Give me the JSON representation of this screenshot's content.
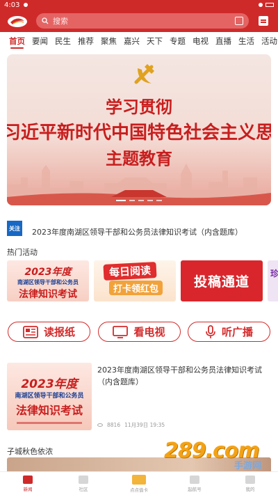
{
  "status_bar": {
    "time": "4:03"
  },
  "header": {
    "search_placeholder": "搜索"
  },
  "tabs": [
    {
      "label": "首页",
      "active": true
    },
    {
      "label": "要闻"
    },
    {
      "label": "民生"
    },
    {
      "label": "推荐"
    },
    {
      "label": "聚焦"
    },
    {
      "label": "嘉兴"
    },
    {
      "label": "天下"
    },
    {
      "label": "专题"
    },
    {
      "label": "电视"
    },
    {
      "label": "直播"
    },
    {
      "label": "生活"
    },
    {
      "label": "活动"
    }
  ],
  "banner": {
    "line1": "学习贯彻",
    "line2": "习近平新时代中国特色社会主义思想",
    "line3": "主题教育"
  },
  "notice": {
    "tag": "关注",
    "text": "2023年度南湖区领导干部和公务员法律知识考试（内含题库）"
  },
  "hot_activities": {
    "title": "热门活动",
    "cards": [
      {
        "line1": "2023年度",
        "line2": "南湖区领导干部和公务员",
        "line3": "法律知识考试"
      },
      {
        "line1": "每日阅读",
        "line2": "打卡领红包"
      },
      {
        "line1": "投稿通道"
      },
      {
        "line1": "珍"
      }
    ]
  },
  "media_buttons": [
    {
      "label": "读报纸",
      "icon": "newspaper-icon"
    },
    {
      "label": "看电视",
      "icon": "tv-icon"
    },
    {
      "label": "听广播",
      "icon": "microphone-icon"
    }
  ],
  "news": {
    "title": "2023年度南湖区领导干部和公务员法律知识考试（内含题库）",
    "views": "8816",
    "date": "11月39日 19:35",
    "thumb": {
      "line1": "2023年度",
      "line2": "南湖区领导干部和公务员",
      "line3": "法律知识考试"
    }
  },
  "section2_title": "子城秋色依浓",
  "watermark": {
    "brand": "289.com",
    "sub": "手游网"
  },
  "bottom_nav": [
    {
      "label": "新闻",
      "active": true
    },
    {
      "label": "社区"
    },
    {
      "label": "点点值卡"
    },
    {
      "label": "起航号"
    },
    {
      "label": "我的"
    }
  ],
  "colors": {
    "brand_red": "#cf2a2a",
    "watermark_orange": "#f3a216"
  }
}
